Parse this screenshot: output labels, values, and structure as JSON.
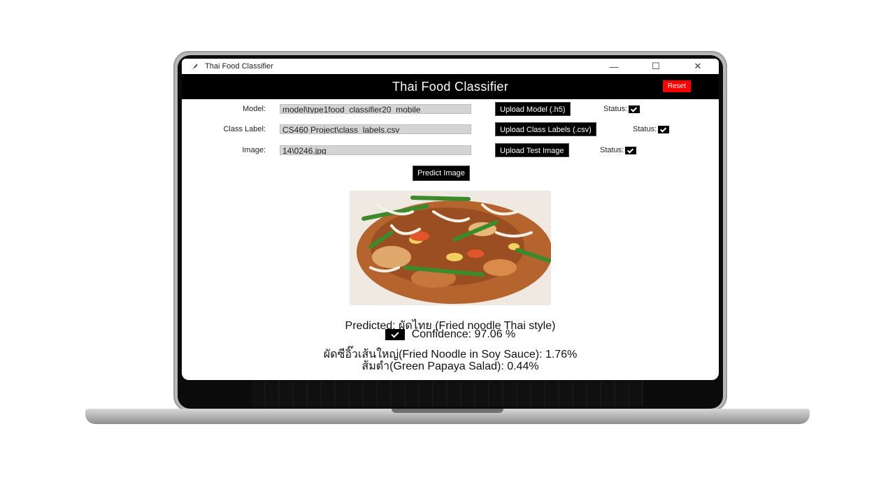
{
  "window": {
    "title": "Thai Food Classifier",
    "controls": {
      "minimize": "—",
      "maximize": "☐",
      "close": "✕"
    }
  },
  "header": {
    "title": "Thai Food Classifier",
    "reset_label": "Reset"
  },
  "rows": {
    "model": {
      "label": "Model:",
      "value": "model\\type1food_classifier20_mobile",
      "button": "Upload Model (.h5)",
      "status": "Status:"
    },
    "class_label": {
      "label": "Class Label:",
      "value": "CS460 Project\\class_labels.csv",
      "button": "Upload Class Labels (.csv)",
      "status": "Status:"
    },
    "image": {
      "label": "Image:",
      "value": "14\\0246.jpg",
      "button": "Upload Test Image",
      "status": "Status:"
    }
  },
  "predict_button": "Predict Image",
  "result": {
    "predicted": "Predicted: ผัดไทย (Fried noodle Thai style)",
    "confidence": "Confidence: 97.06 %",
    "alternatives": [
      "ผัดซีอิ๊วเส้นใหญ่(Fried Noodle in Soy Sauce): 1.76%",
      "ส้มตำ(Green Papaya Salad): 0.44%"
    ]
  },
  "colors": {
    "header_bg": "#000000",
    "reset_bg": "#ff0000",
    "field_bg": "#d4d4d4"
  }
}
